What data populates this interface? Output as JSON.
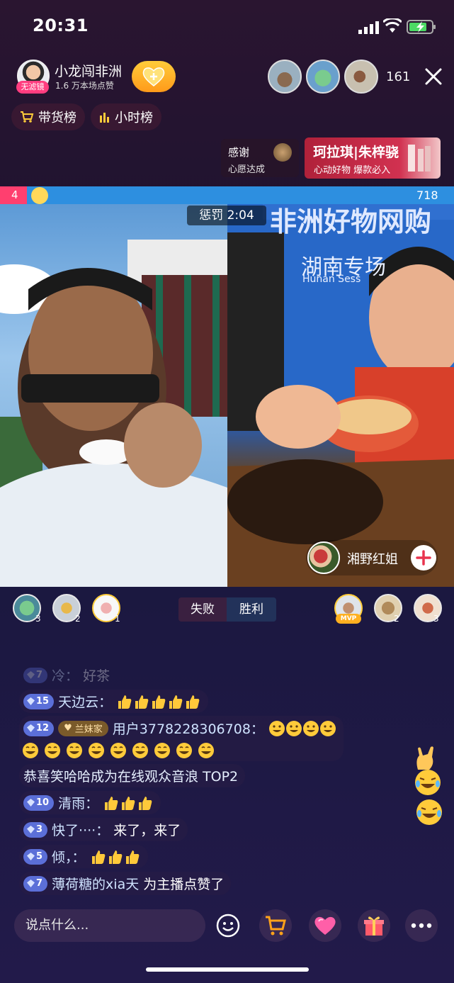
{
  "status_bar": {
    "time": "20:31"
  },
  "host": {
    "badge": "无滤镜",
    "name": "小龙闯非洲",
    "likes": "1.6 万本场点赞"
  },
  "viewers": {
    "count": "161"
  },
  "rank_buttons": {
    "goods": "带货榜",
    "hourly": "小时榜"
  },
  "thanks": {
    "title": "感谢",
    "subtitle": "心愿达成"
  },
  "promo": {
    "title": "珂拉琪|朱梓骁",
    "subtitle": "心动好物 爆款必入"
  },
  "pk": {
    "left_score": "4",
    "right_score": "718"
  },
  "video": {
    "punish_label": "惩罚 2:04",
    "banner_text_top": "非洲好物网购",
    "banner_text_hunan": "湖南专场",
    "banner_text_en": "Hunan Sess",
    "right_host_name": "湘野红姐"
  },
  "result": {
    "fail_label": "失败",
    "win_label": "胜利",
    "left_supporters": [
      "3",
      "2",
      "1"
    ],
    "right_supporters": [
      "MVP",
      "2",
      "3"
    ]
  },
  "chat": [
    {
      "level": "7",
      "user": "冷：",
      "message": "好茶",
      "faded": true
    },
    {
      "level": "15",
      "user": "天边云：",
      "emojis": 5,
      "emoji": "thumbs-up"
    },
    {
      "level": "12",
      "fan_badge": "兰妹家",
      "user": "用户3778228306708：",
      "emojis": 4,
      "emoji": "smile",
      "line2_emojis": 9
    },
    {
      "system": "恭喜笑哈哈成为在线观众音浪 TOP2"
    },
    {
      "level": "10",
      "user": "清雨：",
      "emojis": 3,
      "emoji": "thumbs-up"
    },
    {
      "level": "3",
      "user": "快了····：",
      "message": "来了，来了"
    },
    {
      "level": "5",
      "user": "倾，：",
      "emojis": 3,
      "emoji": "thumbs-up"
    },
    {
      "level": "7",
      "user": "薄荷糖的xia天",
      "message": "为主播点赞了"
    }
  ],
  "bottom": {
    "input_placeholder": "说点什么..."
  },
  "colors": {
    "pk_left": "#ff3f6f",
    "pk_right": "#2d8fe0",
    "level_badge": "#5b6fd8",
    "accent_orange": "#ff9a1a"
  }
}
